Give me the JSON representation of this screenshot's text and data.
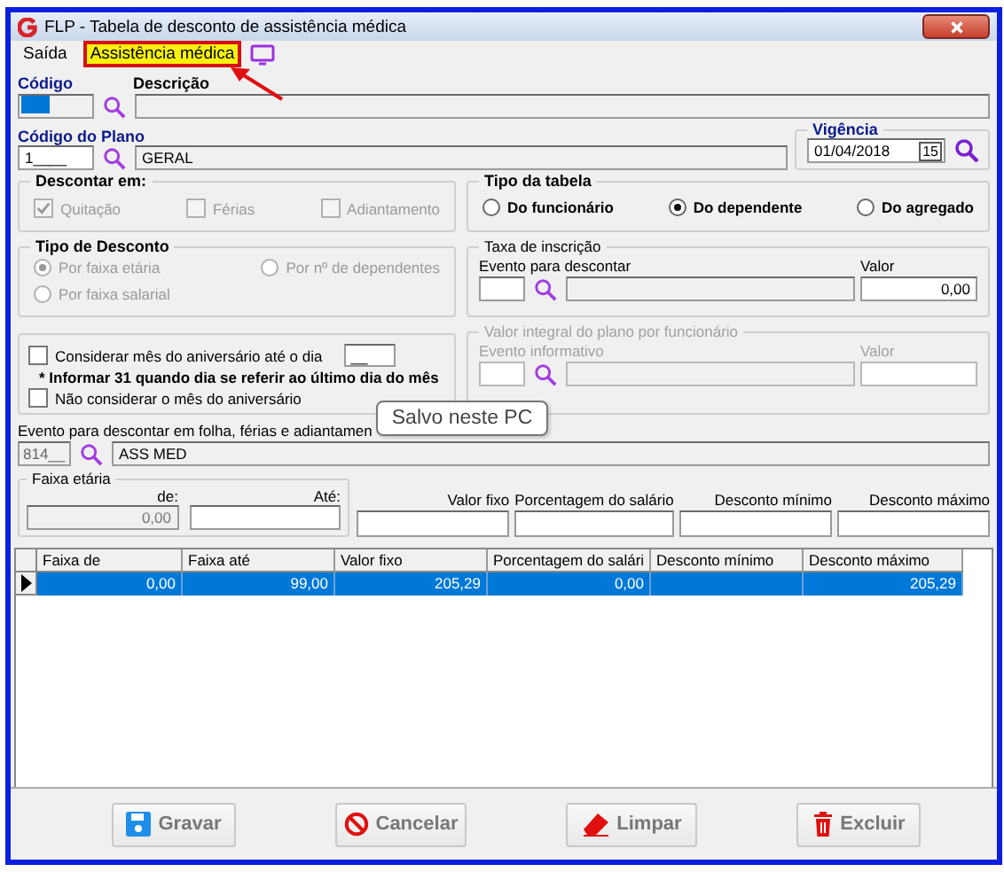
{
  "window": {
    "title": "FLP - Tabela de desconto de assistência médica"
  },
  "menu": [
    {
      "label": "Saída",
      "highlighted": false
    },
    {
      "label": "Assistência médica",
      "highlighted": true
    }
  ],
  "codigo": {
    "label": "Código",
    "focused": true
  },
  "descricao": {
    "label": "Descrição"
  },
  "plano": {
    "label": "Código do Plano",
    "code": "1____",
    "name": "GERAL"
  },
  "vigencia": {
    "title": "Vigência",
    "date": "01/04/2018",
    "calendar_day": "15"
  },
  "descontar_em": {
    "title": "Descontar em:",
    "disabled": true,
    "options": [
      {
        "label": "Quitação",
        "checked": true
      },
      {
        "label": "Férias",
        "checked": false
      },
      {
        "label": "Adiantamento",
        "checked": false
      }
    ]
  },
  "tipo_tabela": {
    "title": "Tipo da tabela",
    "options": [
      {
        "label": "Do funcionário",
        "selected": false
      },
      {
        "label": "Do dependente",
        "selected": true
      },
      {
        "label": "Do agregado",
        "selected": false
      }
    ]
  },
  "tipo_desconto": {
    "title": "Tipo de Desconto",
    "disabled": true,
    "options": [
      {
        "label": "Por faixa etária",
        "selected": true
      },
      {
        "label": "Por nº de dependentes",
        "selected": false
      },
      {
        "label": "Por faixa salarial",
        "selected": false
      }
    ]
  },
  "taxa_inscricao": {
    "title": "Taxa de inscrição",
    "disabled": false,
    "evento_label": "Evento para descontar",
    "valor_label": "Valor",
    "valor": "0,00"
  },
  "aniversario": {
    "considerar_label": "Considerar mês do aniversário até o dia",
    "considerar_checked": false,
    "day": "__",
    "note": "* Informar 31 quando dia se referir ao último dia do mês",
    "nao_considerar_label": "Não considerar o mês do aniversário",
    "nao_considerar_checked": false
  },
  "valor_integral": {
    "title": "Valor integral do plano por funcionário",
    "disabled": true,
    "evento_label": "Evento informativo",
    "valor_label": "Valor"
  },
  "evento_folha": {
    "label": "Evento para descontar em folha, férias e adiantamen",
    "code": "814__",
    "name": "ASS MED"
  },
  "tooltip": "Salvo neste PC",
  "faixa_etaria": {
    "title": "Faixa etária",
    "de_label": "de:",
    "de_value": "0,00",
    "ate_label": "Até:"
  },
  "valores": [
    {
      "label": "Valor fixo"
    },
    {
      "label": "Porcentagem do salário"
    },
    {
      "label": "Desconto mínimo"
    },
    {
      "label": "Desconto máximo"
    }
  ],
  "table": {
    "columns": [
      "Faixa de",
      "Faixa até",
      "Valor fixo",
      "Porcentagem do salári",
      "Desconto mínimo",
      "Desconto máximo"
    ],
    "rows": [
      {
        "selected": true,
        "cells": [
          "0,00",
          "99,00",
          "205,29",
          "0,00",
          null,
          "205,29"
        ]
      }
    ]
  },
  "buttons": [
    {
      "label": "Gravar",
      "kind": "save"
    },
    {
      "label": "Cancelar",
      "kind": "cancel"
    },
    {
      "label": "Limpar",
      "kind": "clear"
    },
    {
      "label": "Excluir",
      "kind": "delete"
    }
  ]
}
